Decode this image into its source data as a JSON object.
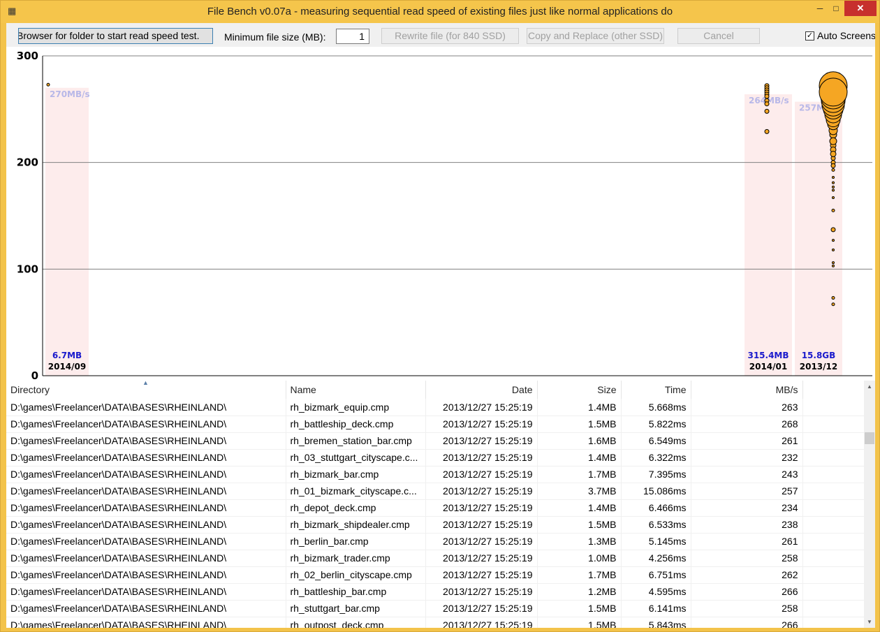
{
  "window": {
    "title": "File Bench v0.07a - measuring sequential read speed of existing files just like normal applications do",
    "minimize_glyph": "─",
    "maximize_glyph": "□",
    "close_glyph": "✕",
    "app_icon": "grid-app-icon"
  },
  "toolbar": {
    "browse_label": "Browser for folder to start read speed test.",
    "min_size_label": "Minimum file size (MB):",
    "min_size_value": "1",
    "rewrite_label": "Rewrite file (for 840 SSD)",
    "copy_label": "Copy and Replace (other SSD)",
    "cancel_label": "Cancel",
    "auto_label": "Auto Screenshot",
    "auto_checked": true
  },
  "chart_data": {
    "type": "scatter",
    "y_ticks": [
      "300",
      "200",
      "100",
      "0"
    ],
    "ylim": [
      0,
      300
    ],
    "gridlines": [
      100,
      200,
      300
    ],
    "groups": [
      {
        "date": "2014/09",
        "size": "6.7MB",
        "speed_label": "270MB/s",
        "avg": 270,
        "points": [
          {
            "v": 273,
            "s": 2
          }
        ]
      },
      {
        "date": "2014/01",
        "size": "315.4MB",
        "speed_label": "264MB/s",
        "avg": 264,
        "points": [
          {
            "v": 272,
            "s": 3
          },
          {
            "v": 270,
            "s": 3
          },
          {
            "v": 268,
            "s": 3
          },
          {
            "v": 266,
            "s": 3
          },
          {
            "v": 264,
            "s": 3
          },
          {
            "v": 262,
            "s": 3
          },
          {
            "v": 258,
            "s": 3
          },
          {
            "v": 255,
            "s": 3
          },
          {
            "v": 248,
            "s": 3
          },
          {
            "v": 229,
            "s": 3
          }
        ]
      },
      {
        "date": "2013/12",
        "size": "15.8GB",
        "speed_label": "257MB/s",
        "avg": 257,
        "points": [
          {
            "v": 272,
            "s": 20
          },
          {
            "v": 266,
            "s": 20
          },
          {
            "v": 262,
            "s": 18
          },
          {
            "v": 258,
            "s": 17
          },
          {
            "v": 254,
            "s": 16
          },
          {
            "v": 250,
            "s": 14
          },
          {
            "v": 245,
            "s": 12
          },
          {
            "v": 240,
            "s": 10
          },
          {
            "v": 236,
            "s": 8
          },
          {
            "v": 230,
            "s": 6
          },
          {
            "v": 226,
            "s": 5
          },
          {
            "v": 220,
            "s": 5
          },
          {
            "v": 216,
            "s": 4
          },
          {
            "v": 212,
            "s": 4
          },
          {
            "v": 208,
            "s": 4
          },
          {
            "v": 204,
            "s": 3
          },
          {
            "v": 200,
            "s": 3
          },
          {
            "v": 197,
            "s": 3
          },
          {
            "v": 193,
            "s": 2
          },
          {
            "v": 186,
            "s": 1.5
          },
          {
            "v": 181,
            "s": 1.5
          },
          {
            "v": 177,
            "s": 1.5
          },
          {
            "v": 174,
            "s": 1.5
          },
          {
            "v": 167,
            "s": 1.5
          },
          {
            "v": 155,
            "s": 2
          },
          {
            "v": 137,
            "s": 3
          },
          {
            "v": 127,
            "s": 1.5
          },
          {
            "v": 118,
            "s": 1.5
          },
          {
            "v": 106,
            "s": 1.5
          },
          {
            "v": 103,
            "s": 1.5
          },
          {
            "v": 73,
            "s": 2
          },
          {
            "v": 67,
            "s": 2
          }
        ]
      }
    ]
  },
  "table": {
    "columns": [
      "Directory",
      "Name",
      "Date",
      "Size",
      "Time",
      "MB/s"
    ],
    "rows": [
      [
        "D:\\games\\Freelancer\\DATA\\BASES\\RHEINLAND\\",
        "rh_bizmark_equip.cmp",
        "2013/12/27 15:25:19",
        "1.4MB",
        "5.668ms",
        "263"
      ],
      [
        "D:\\games\\Freelancer\\DATA\\BASES\\RHEINLAND\\",
        "rh_battleship_deck.cmp",
        "2013/12/27 15:25:19",
        "1.5MB",
        "5.822ms",
        "268"
      ],
      [
        "D:\\games\\Freelancer\\DATA\\BASES\\RHEINLAND\\",
        "rh_bremen_station_bar.cmp",
        "2013/12/27 15:25:19",
        "1.6MB",
        "6.549ms",
        "261"
      ],
      [
        "D:\\games\\Freelancer\\DATA\\BASES\\RHEINLAND\\",
        "rh_03_stuttgart_cityscape.c...",
        "2013/12/27 15:25:19",
        "1.4MB",
        "6.322ms",
        "232"
      ],
      [
        "D:\\games\\Freelancer\\DATA\\BASES\\RHEINLAND\\",
        "rh_bizmark_bar.cmp",
        "2013/12/27 15:25:19",
        "1.7MB",
        "7.395ms",
        "243"
      ],
      [
        "D:\\games\\Freelancer\\DATA\\BASES\\RHEINLAND\\",
        "rh_01_bizmark_cityscape.c...",
        "2013/12/27 15:25:19",
        "3.7MB",
        "15.086ms",
        "257"
      ],
      [
        "D:\\games\\Freelancer\\DATA\\BASES\\RHEINLAND\\",
        "rh_depot_deck.cmp",
        "2013/12/27 15:25:19",
        "1.4MB",
        "6.466ms",
        "234"
      ],
      [
        "D:\\games\\Freelancer\\DATA\\BASES\\RHEINLAND\\",
        "rh_bizmark_shipdealer.cmp",
        "2013/12/27 15:25:19",
        "1.5MB",
        "6.533ms",
        "238"
      ],
      [
        "D:\\games\\Freelancer\\DATA\\BASES\\RHEINLAND\\",
        "rh_berlin_bar.cmp",
        "2013/12/27 15:25:19",
        "1.3MB",
        "5.145ms",
        "261"
      ],
      [
        "D:\\games\\Freelancer\\DATA\\BASES\\RHEINLAND\\",
        "rh_bizmark_trader.cmp",
        "2013/12/27 15:25:19",
        "1.0MB",
        "4.256ms",
        "258"
      ],
      [
        "D:\\games\\Freelancer\\DATA\\BASES\\RHEINLAND\\",
        "rh_02_berlin_cityscape.cmp",
        "2013/12/27 15:25:19",
        "1.7MB",
        "6.751ms",
        "262"
      ],
      [
        "D:\\games\\Freelancer\\DATA\\BASES\\RHEINLAND\\",
        "rh_battleship_bar.cmp",
        "2013/12/27 15:25:19",
        "1.2MB",
        "4.595ms",
        "266"
      ],
      [
        "D:\\games\\Freelancer\\DATA\\BASES\\RHEINLAND\\",
        "rh_stuttgart_bar.cmp",
        "2013/12/27 15:25:19",
        "1.5MB",
        "6.141ms",
        "258"
      ],
      [
        "D:\\games\\Freelancer\\DATA\\BASES\\RHEINLAND\\",
        "rh_outpost_deck.cmp",
        "2013/12/27 15:25:19",
        "1.5MB",
        "5.843ms",
        "266"
      ]
    ]
  },
  "colors": {
    "titlebar": "#f5c54b",
    "close": "#c7302d",
    "bubble": "#f5a623",
    "band": "#fdecec",
    "speed_label": "#b8b8e8",
    "size_label": "#1a1acc"
  }
}
